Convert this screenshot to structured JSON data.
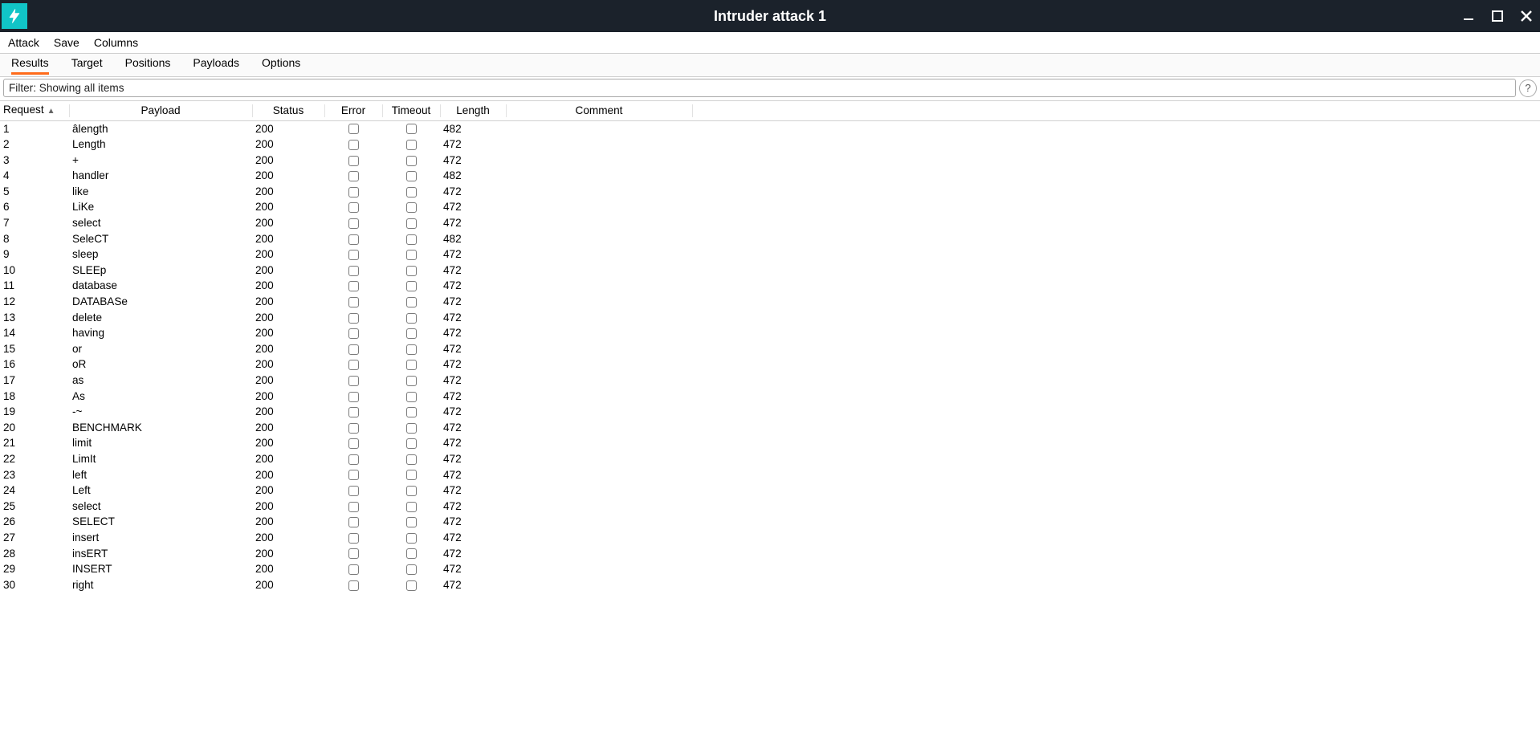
{
  "window": {
    "title": "Intruder attack 1"
  },
  "menu": {
    "items": [
      "Attack",
      "Save",
      "Columns"
    ]
  },
  "tabs": {
    "items": [
      "Results",
      "Target",
      "Positions",
      "Payloads",
      "Options"
    ],
    "active_index": 0
  },
  "filter": {
    "text": "Filter: Showing all items"
  },
  "table": {
    "columns": {
      "request": "Request",
      "payload": "Payload",
      "status": "Status",
      "error": "Error",
      "timeout": "Timeout",
      "length": "Length",
      "comment": "Comment"
    },
    "sort_column": "request",
    "sort_dir": "asc",
    "rows": [
      {
        "request": "1",
        "payload": "âlength",
        "status": "200",
        "error": false,
        "timeout": false,
        "length": "482",
        "comment": ""
      },
      {
        "request": "2",
        "payload": "Length",
        "status": "200",
        "error": false,
        "timeout": false,
        "length": "472",
        "comment": ""
      },
      {
        "request": "3",
        "payload": "+",
        "status": "200",
        "error": false,
        "timeout": false,
        "length": "472",
        "comment": ""
      },
      {
        "request": "4",
        "payload": "handler",
        "status": "200",
        "error": false,
        "timeout": false,
        "length": "482",
        "comment": ""
      },
      {
        "request": "5",
        "payload": "like",
        "status": "200",
        "error": false,
        "timeout": false,
        "length": "472",
        "comment": ""
      },
      {
        "request": "6",
        "payload": "LiKe",
        "status": "200",
        "error": false,
        "timeout": false,
        "length": "472",
        "comment": ""
      },
      {
        "request": "7",
        "payload": "select",
        "status": "200",
        "error": false,
        "timeout": false,
        "length": "472",
        "comment": ""
      },
      {
        "request": "8",
        "payload": "SeleCT",
        "status": "200",
        "error": false,
        "timeout": false,
        "length": "482",
        "comment": ""
      },
      {
        "request": "9",
        "payload": "sleep",
        "status": "200",
        "error": false,
        "timeout": false,
        "length": "472",
        "comment": ""
      },
      {
        "request": "10",
        "payload": "SLEEp",
        "status": "200",
        "error": false,
        "timeout": false,
        "length": "472",
        "comment": ""
      },
      {
        "request": "11",
        "payload": "database",
        "status": "200",
        "error": false,
        "timeout": false,
        "length": "472",
        "comment": ""
      },
      {
        "request": "12",
        "payload": "DATABASe",
        "status": "200",
        "error": false,
        "timeout": false,
        "length": "472",
        "comment": ""
      },
      {
        "request": "13",
        "payload": "delete",
        "status": "200",
        "error": false,
        "timeout": false,
        "length": "472",
        "comment": ""
      },
      {
        "request": "14",
        "payload": "having",
        "status": "200",
        "error": false,
        "timeout": false,
        "length": "472",
        "comment": ""
      },
      {
        "request": "15",
        "payload": "or",
        "status": "200",
        "error": false,
        "timeout": false,
        "length": "472",
        "comment": ""
      },
      {
        "request": "16",
        "payload": "oR",
        "status": "200",
        "error": false,
        "timeout": false,
        "length": "472",
        "comment": ""
      },
      {
        "request": "17",
        "payload": "as",
        "status": "200",
        "error": false,
        "timeout": false,
        "length": "472",
        "comment": ""
      },
      {
        "request": "18",
        "payload": "As",
        "status": "200",
        "error": false,
        "timeout": false,
        "length": "472",
        "comment": ""
      },
      {
        "request": "19",
        "payload": "-~",
        "status": "200",
        "error": false,
        "timeout": false,
        "length": "472",
        "comment": ""
      },
      {
        "request": "20",
        "payload": "BENCHMARK",
        "status": "200",
        "error": false,
        "timeout": false,
        "length": "472",
        "comment": ""
      },
      {
        "request": "21",
        "payload": "limit",
        "status": "200",
        "error": false,
        "timeout": false,
        "length": "472",
        "comment": ""
      },
      {
        "request": "22",
        "payload": "LimIt",
        "status": "200",
        "error": false,
        "timeout": false,
        "length": "472",
        "comment": ""
      },
      {
        "request": "23",
        "payload": "left",
        "status": "200",
        "error": false,
        "timeout": false,
        "length": "472",
        "comment": ""
      },
      {
        "request": "24",
        "payload": "Left",
        "status": "200",
        "error": false,
        "timeout": false,
        "length": "472",
        "comment": ""
      },
      {
        "request": "25",
        "payload": "select",
        "status": "200",
        "error": false,
        "timeout": false,
        "length": "472",
        "comment": ""
      },
      {
        "request": "26",
        "payload": "SELECT",
        "status": "200",
        "error": false,
        "timeout": false,
        "length": "472",
        "comment": ""
      },
      {
        "request": "27",
        "payload": "insert",
        "status": "200",
        "error": false,
        "timeout": false,
        "length": "472",
        "comment": ""
      },
      {
        "request": "28",
        "payload": "insERT",
        "status": "200",
        "error": false,
        "timeout": false,
        "length": "472",
        "comment": ""
      },
      {
        "request": "29",
        "payload": "INSERT",
        "status": "200",
        "error": false,
        "timeout": false,
        "length": "472",
        "comment": ""
      },
      {
        "request": "30",
        "payload": "right",
        "status": "200",
        "error": false,
        "timeout": false,
        "length": "472",
        "comment": ""
      }
    ]
  }
}
